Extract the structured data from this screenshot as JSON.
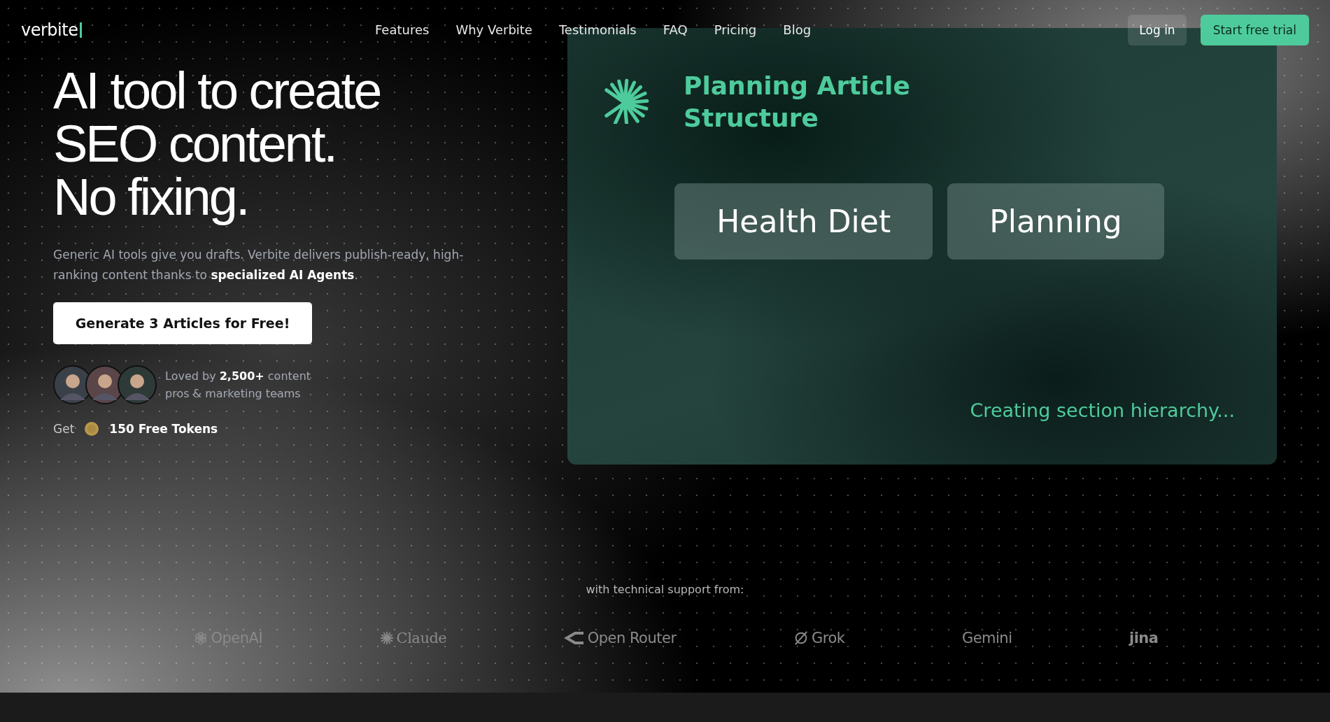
{
  "header": {
    "logo": "verbite",
    "nav": [
      "Features",
      "Why Verbite",
      "Testimonials",
      "FAQ",
      "Pricing",
      "Blog"
    ],
    "login": "Log in",
    "cta": "Start free trial"
  },
  "hero": {
    "heading_lines": [
      "AI tool to create",
      "SEO content.",
      "No fixing."
    ],
    "description": "Generic AI tools give you drafts. Verbite delivers publish-ready, high-ranking content thanks to **specialized AI Agents**.",
    "cta": "Generate 3 Articles for Free!",
    "social_proof": "Loved by **2,500+** content pros & marketing teams",
    "tokens_prefix": "Get",
    "tokens": "150 Free Tokens"
  },
  "demo": {
    "title": "Planning Article Structure",
    "keywords": [
      "Health Diet",
      "Planning"
    ],
    "status": "Creating section hierarchy..."
  },
  "partners": {
    "label": "with technical support from:",
    "logos": [
      {
        "name": "OpenAI",
        "kind": "openai"
      },
      {
        "name": "Claude",
        "kind": "claude"
      },
      {
        "name": "Open Router",
        "kind": "openrouter"
      },
      {
        "name": "Grok",
        "kind": "grok"
      },
      {
        "name": "Gemini",
        "kind": "gemini"
      },
      {
        "name": "jina",
        "kind": "jina"
      }
    ]
  }
}
